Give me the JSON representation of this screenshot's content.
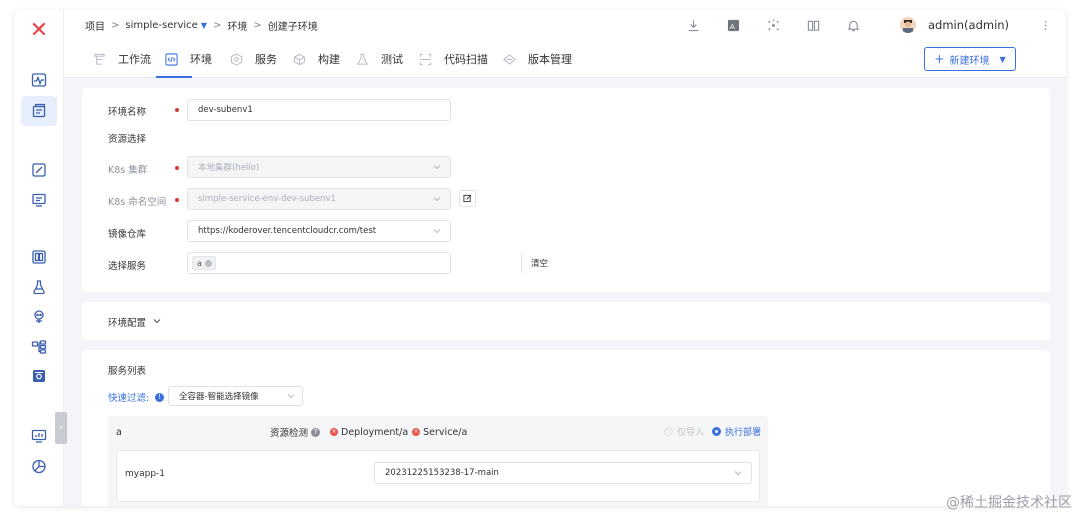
{
  "breadcrumb": {
    "project": "项目",
    "service": "simple-service",
    "env": "环境",
    "current": "创建子环境"
  },
  "user": {
    "name": "admin(admin)"
  },
  "tabs": [
    {
      "label": "工作流",
      "icon": "workflow-icon",
      "active": false
    },
    {
      "label": "环境",
      "icon": "code-icon",
      "active": true
    },
    {
      "label": "服务",
      "icon": "service-icon",
      "active": false
    },
    {
      "label": "构建",
      "icon": "build-icon",
      "active": false
    },
    {
      "label": "测试",
      "icon": "test-flask-icon",
      "active": false
    },
    {
      "label": "代码扫描",
      "icon": "scan-icon",
      "active": false
    },
    {
      "label": "版本管理",
      "icon": "version-icon",
      "active": false
    }
  ],
  "new_env_button": "新建环境",
  "form": {
    "env_name_label": "环境名称",
    "env_name_value": "dev-subenv1",
    "resource_select_label": "资源选择",
    "k8s_cluster_label": "K8s 集群",
    "k8s_cluster_value": "本地集群(hello)",
    "k8s_namespace_label": "K8s 命名空间",
    "k8s_namespace_value": "simple-service-env-dev-subenv1",
    "image_registry_label": "镜像仓库",
    "image_registry_value": "https://koderover.tencentcloudcr.com/test",
    "select_service_label": "选择服务",
    "selected_service_tag": "a",
    "clear_button": "清空"
  },
  "env_config": {
    "label": "环境配置"
  },
  "service_list": {
    "title": "服务列表",
    "quick_filter_label": "快速过滤:",
    "filter_value": "全容器-智能选择镜像",
    "service_name": "a",
    "resource_check_label": "资源检测",
    "resources": [
      "Deployment/a",
      "Service/a"
    ],
    "import_only_label": "仅导入",
    "deploy_label": "执行部署",
    "container_name": "myapp-1",
    "image_value": "20231225153238-17-main"
  },
  "watermark": "@稀土掘金技术社区",
  "colors": {
    "accent": "#3a6fe0",
    "logo": "#e4464a",
    "required": "#d43a3a",
    "error": "#e8564d"
  }
}
